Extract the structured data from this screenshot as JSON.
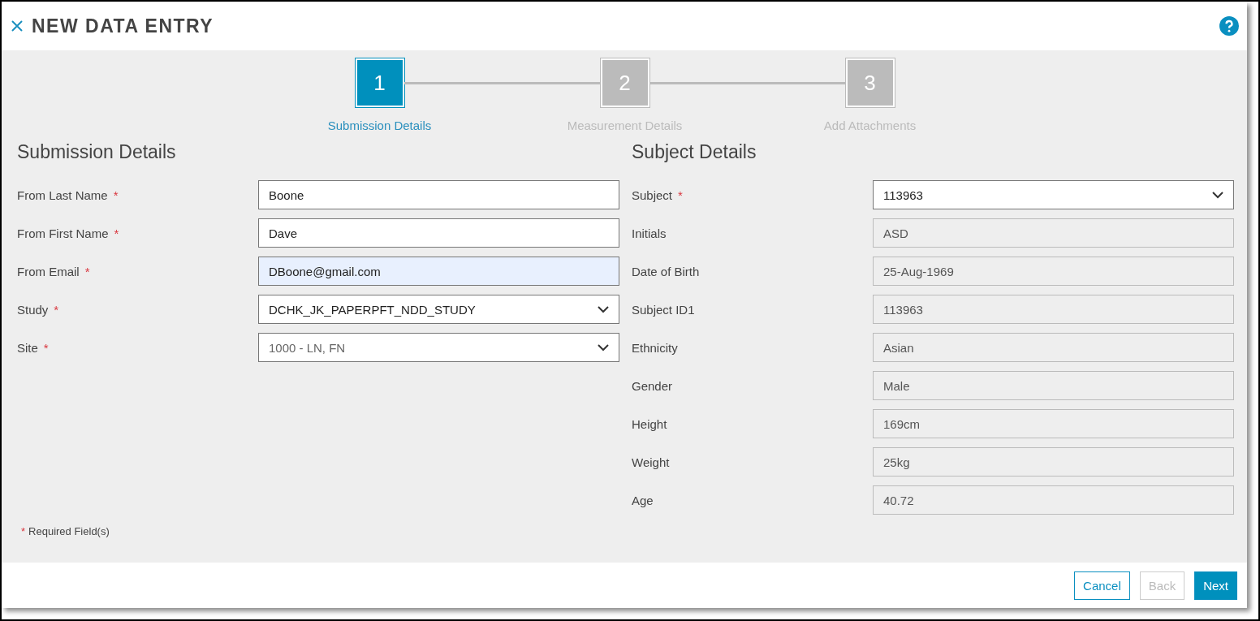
{
  "dialog": {
    "title": "NEW DATA ENTRY"
  },
  "steps": [
    {
      "number": "1",
      "label": "Submission Details",
      "selected": true
    },
    {
      "number": "2",
      "label": "Measurement Details",
      "selected": false
    },
    {
      "number": "3",
      "label": "Add Attachments",
      "selected": false
    }
  ],
  "submission_details": {
    "heading": "Submission Details",
    "fields": [
      {
        "label": "From Last Name",
        "marker": "*",
        "kind": "input",
        "value": "Boone",
        "autofilled": false,
        "disabled": false
      },
      {
        "label": "From First Name",
        "marker": "*",
        "kind": "input",
        "value": "Dave",
        "autofilled": false,
        "disabled": false
      },
      {
        "label": "From Email",
        "marker": "*",
        "kind": "input",
        "value": "DBoone@gmail.com",
        "autofilled": true,
        "disabled": false
      },
      {
        "label": "Study",
        "marker": "*",
        "kind": "select",
        "value": "DCHK_JK_PAPERPFT_NDD_STUDY",
        "autofilled": false,
        "disabled": false
      },
      {
        "label": "Site",
        "marker": "*",
        "kind": "select",
        "value": "1000 - LN, FN",
        "autofilled": false,
        "disabled": true
      }
    ]
  },
  "subject_details": {
    "heading": "Subject Details",
    "fields": [
      {
        "label": "Subject",
        "marker": "*",
        "kind": "select",
        "value": "113963",
        "autofilled": false,
        "disabled": false
      },
      {
        "label": "Initials",
        "kind": "readonly",
        "value": "ASD"
      },
      {
        "label": "Date of Birth",
        "kind": "readonly",
        "value": "25-Aug-1969"
      },
      {
        "label": "Subject ID1",
        "kind": "readonly",
        "value": "113963"
      },
      {
        "label": "Ethnicity",
        "kind": "readonly",
        "value": "Asian"
      },
      {
        "label": "Gender",
        "kind": "readonly",
        "value": "Male"
      },
      {
        "label": "Height",
        "kind": "readonly",
        "value": "169cm"
      },
      {
        "label": "Weight",
        "kind": "readonly",
        "value": "25kg"
      },
      {
        "label": "Age",
        "kind": "readonly",
        "value": "40.72"
      }
    ]
  },
  "required_note": {
    "marker": "*",
    "text": "Required Field(s)"
  },
  "buttons": [
    {
      "label": "Cancel",
      "kind": "outline",
      "disabled": false
    },
    {
      "label": "Back",
      "kind": "outline",
      "disabled": true
    },
    {
      "label": "Next",
      "kind": "primary",
      "disabled": false
    }
  ]
}
